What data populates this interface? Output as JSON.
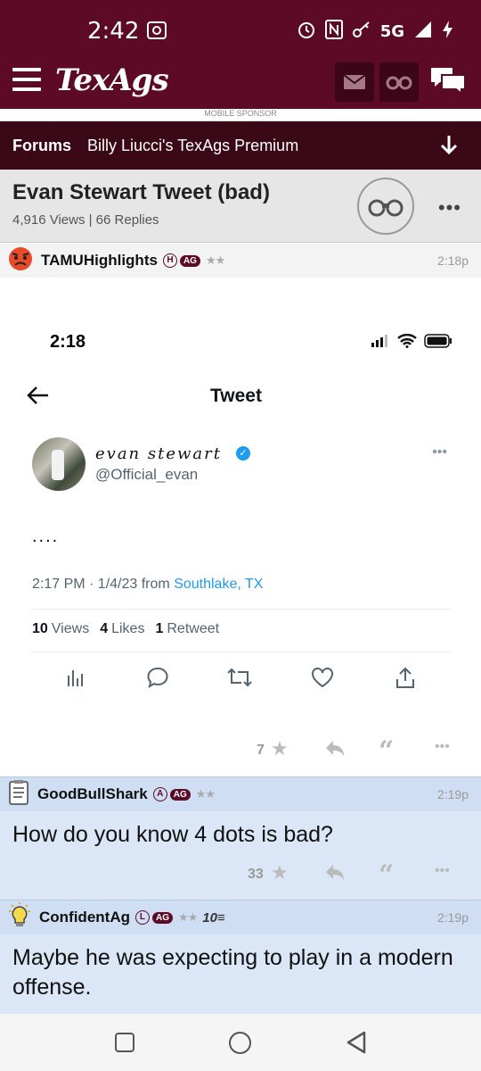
{
  "status": {
    "time": "2:42",
    "network": "5G"
  },
  "app": {
    "logo": "TexAgs",
    "ad_text": "MOBILE SPONSOR"
  },
  "forum_bar": {
    "label": "Forums",
    "forum_name": "Billy Liucci's TexAgs Premium"
  },
  "thread": {
    "title": "Evan Stewart Tweet (bad)",
    "meta": "4,916 Views | 66 Replies"
  },
  "posts": [
    {
      "author": "TAMUHighlights",
      "badge": "H",
      "ag": "AG",
      "stars": "★★",
      "time": "2:18p",
      "likes": "7"
    },
    {
      "author": "GoodBullShark",
      "badge": "A",
      "ag": "AG",
      "stars": "★★",
      "time": "2:19p",
      "text": "How do you know 4 dots is bad?",
      "likes": "33"
    },
    {
      "author": "ConfidentAg",
      "badge": "L",
      "ag": "AG",
      "stars": "★★",
      "extra": "10≡",
      "time": "2:19p",
      "text": "Maybe he was expecting to play in a modern offense."
    }
  ],
  "tweet": {
    "phone_time": "2:18",
    "header": "Tweet",
    "name": "evan stewart",
    "handle": "@Official_evan",
    "text": "....",
    "date": "2:17 PM · 1/4/23 from",
    "location": "Southlake, TX",
    "views_count": "10",
    "views_label": "Views",
    "likes_count": "4",
    "likes_label": "Likes",
    "retweets_count": "1",
    "retweets_label": "Retweet"
  }
}
